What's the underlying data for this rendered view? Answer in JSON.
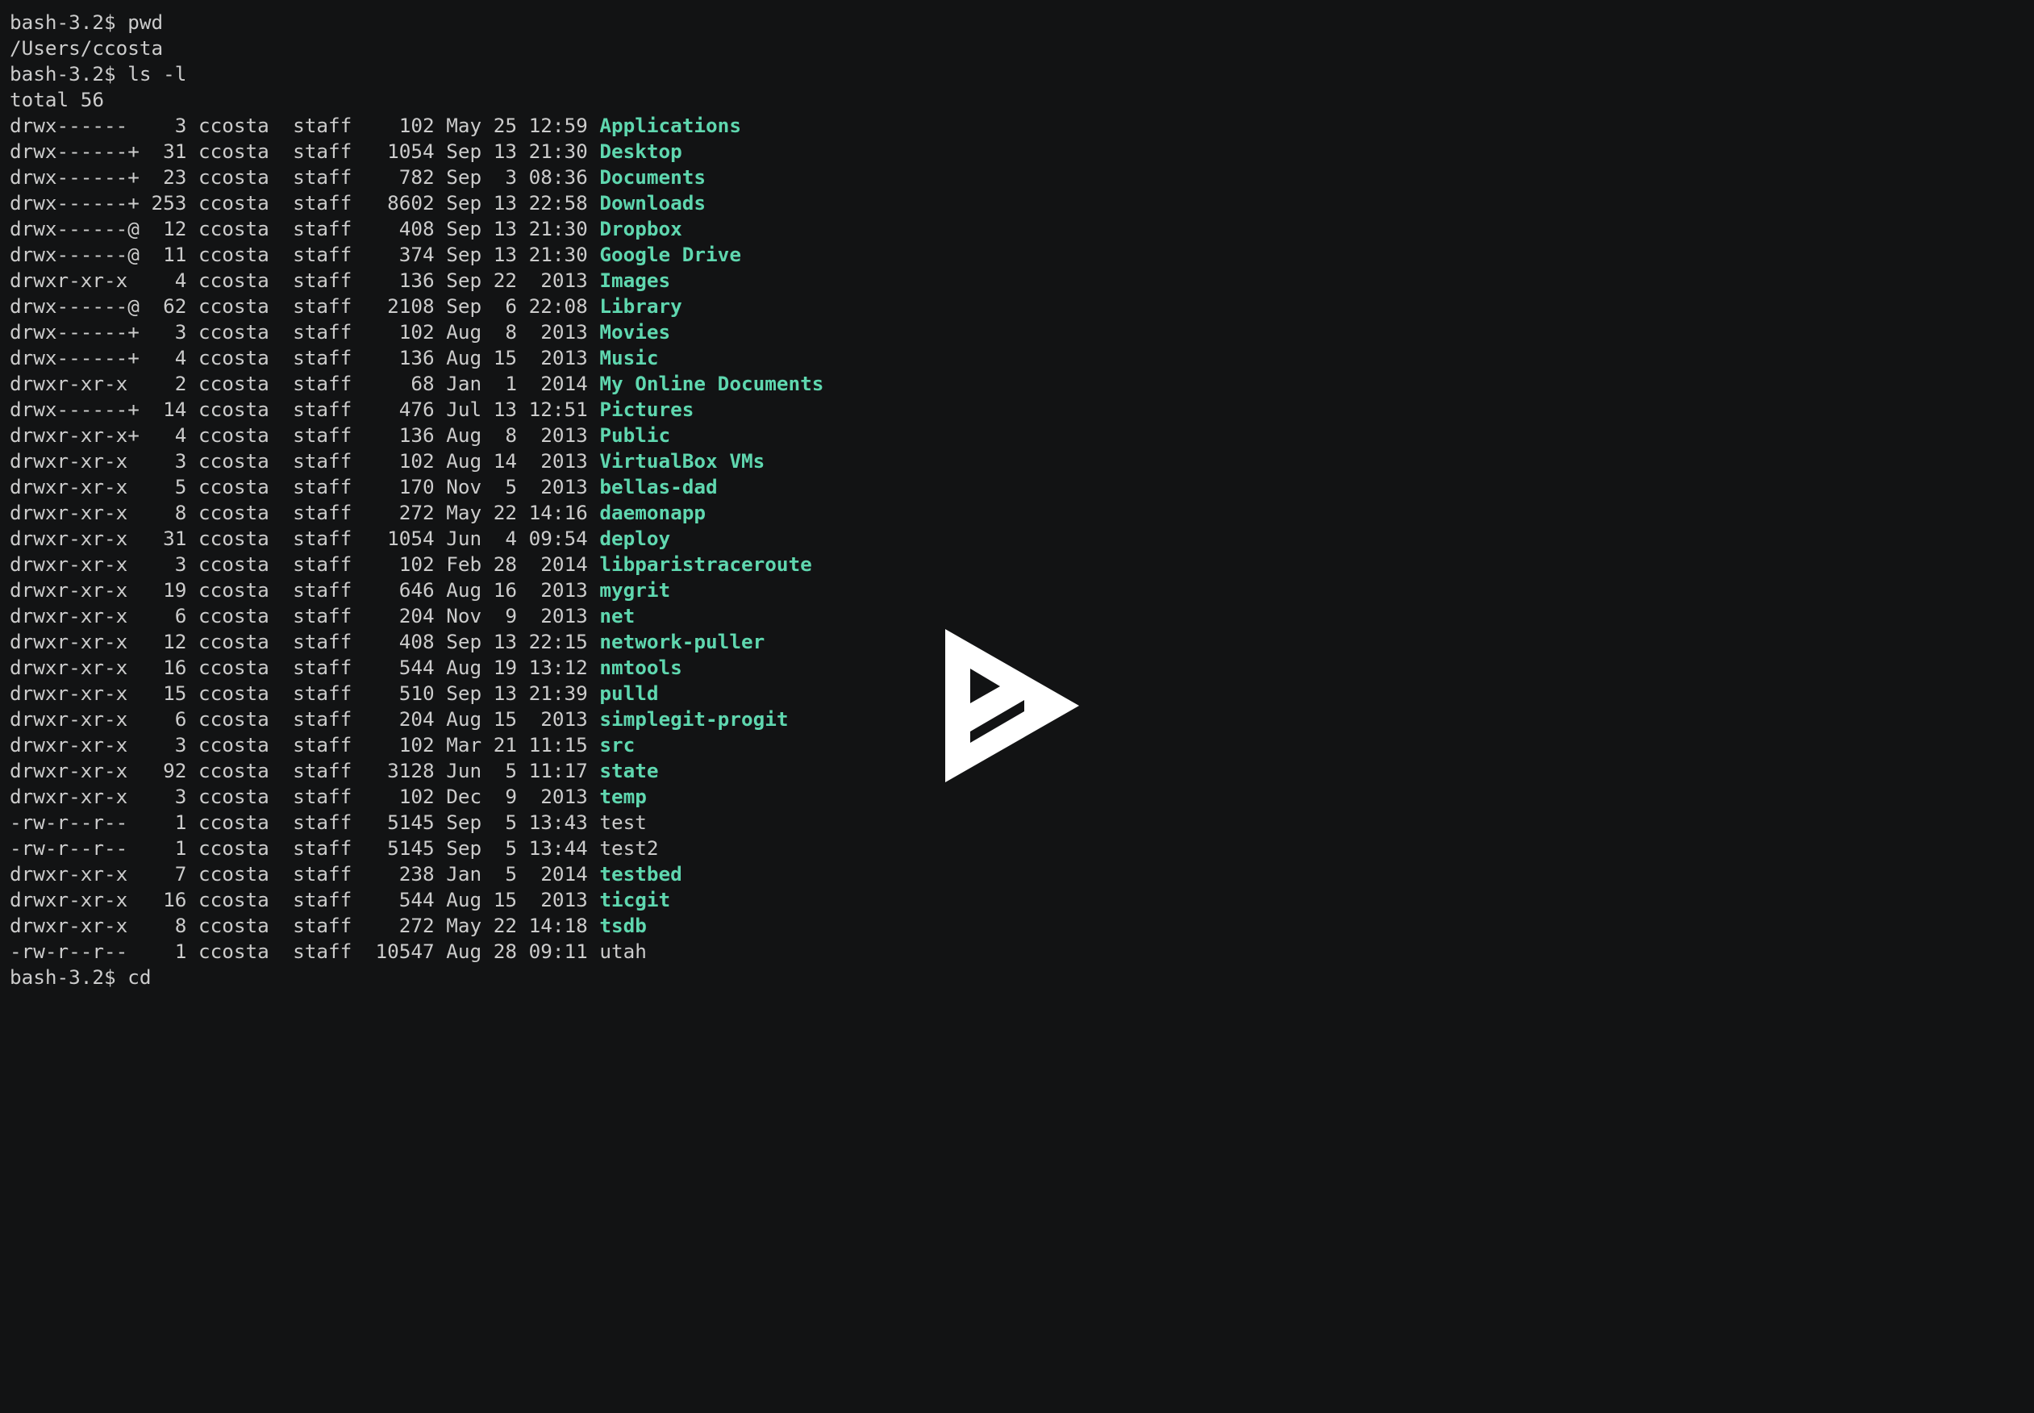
{
  "colors": {
    "background": "#121314",
    "foreground": "#cccccc",
    "directory": "#5fd7af"
  },
  "terminal": {
    "lines": [
      {
        "type": "text",
        "text": "bash-3.2$ pwd"
      },
      {
        "type": "text",
        "text": "/Users/ccosta"
      },
      {
        "type": "text",
        "text": "bash-3.2$ ls -l"
      },
      {
        "type": "text",
        "text": "total 56"
      },
      {
        "type": "entry",
        "meta": "drwx------    3 ccosta  staff    102 May 25 12:59 ",
        "name": "Applications",
        "kind": "dir"
      },
      {
        "type": "entry",
        "meta": "drwx------+  31 ccosta  staff   1054 Sep 13 21:30 ",
        "name": "Desktop",
        "kind": "dir"
      },
      {
        "type": "entry",
        "meta": "drwx------+  23 ccosta  staff    782 Sep  3 08:36 ",
        "name": "Documents",
        "kind": "dir"
      },
      {
        "type": "entry",
        "meta": "drwx------+ 253 ccosta  staff   8602 Sep 13 22:58 ",
        "name": "Downloads",
        "kind": "dir"
      },
      {
        "type": "entry",
        "meta": "drwx------@  12 ccosta  staff    408 Sep 13 21:30 ",
        "name": "Dropbox",
        "kind": "dir"
      },
      {
        "type": "entry",
        "meta": "drwx------@  11 ccosta  staff    374 Sep 13 21:30 ",
        "name": "Google Drive",
        "kind": "dir"
      },
      {
        "type": "entry",
        "meta": "drwxr-xr-x    4 ccosta  staff    136 Sep 22  2013 ",
        "name": "Images",
        "kind": "dir"
      },
      {
        "type": "entry",
        "meta": "drwx------@  62 ccosta  staff   2108 Sep  6 22:08 ",
        "name": "Library",
        "kind": "dir"
      },
      {
        "type": "entry",
        "meta": "drwx------+   3 ccosta  staff    102 Aug  8  2013 ",
        "name": "Movies",
        "kind": "dir"
      },
      {
        "type": "entry",
        "meta": "drwx------+   4 ccosta  staff    136 Aug 15  2013 ",
        "name": "Music",
        "kind": "dir"
      },
      {
        "type": "entry",
        "meta": "drwxr-xr-x    2 ccosta  staff     68 Jan  1  2014 ",
        "name": "My Online Documents",
        "kind": "dir"
      },
      {
        "type": "entry",
        "meta": "drwx------+  14 ccosta  staff    476 Jul 13 12:51 ",
        "name": "Pictures",
        "kind": "dir"
      },
      {
        "type": "entry",
        "meta": "drwxr-xr-x+   4 ccosta  staff    136 Aug  8  2013 ",
        "name": "Public",
        "kind": "dir"
      },
      {
        "type": "entry",
        "meta": "drwxr-xr-x    3 ccosta  staff    102 Aug 14  2013 ",
        "name": "VirtualBox VMs",
        "kind": "dir"
      },
      {
        "type": "entry",
        "meta": "drwxr-xr-x    5 ccosta  staff    170 Nov  5  2013 ",
        "name": "bellas-dad",
        "kind": "dir"
      },
      {
        "type": "entry",
        "meta": "drwxr-xr-x    8 ccosta  staff    272 May 22 14:16 ",
        "name": "daemonapp",
        "kind": "dir"
      },
      {
        "type": "entry",
        "meta": "drwxr-xr-x   31 ccosta  staff   1054 Jun  4 09:54 ",
        "name": "deploy",
        "kind": "dir"
      },
      {
        "type": "entry",
        "meta": "drwxr-xr-x    3 ccosta  staff    102 Feb 28  2014 ",
        "name": "libparistraceroute",
        "kind": "dir"
      },
      {
        "type": "entry",
        "meta": "drwxr-xr-x   19 ccosta  staff    646 Aug 16  2013 ",
        "name": "mygrit",
        "kind": "dir"
      },
      {
        "type": "entry",
        "meta": "drwxr-xr-x    6 ccosta  staff    204 Nov  9  2013 ",
        "name": "net",
        "kind": "dir"
      },
      {
        "type": "entry",
        "meta": "drwxr-xr-x   12 ccosta  staff    408 Sep 13 22:15 ",
        "name": "network-puller",
        "kind": "dir"
      },
      {
        "type": "entry",
        "meta": "drwxr-xr-x   16 ccosta  staff    544 Aug 19 13:12 ",
        "name": "nmtools",
        "kind": "dir"
      },
      {
        "type": "entry",
        "meta": "drwxr-xr-x   15 ccosta  staff    510 Sep 13 21:39 ",
        "name": "pulld",
        "kind": "dir"
      },
      {
        "type": "entry",
        "meta": "drwxr-xr-x    6 ccosta  staff    204 Aug 15  2013 ",
        "name": "simplegit-progit",
        "kind": "dir"
      },
      {
        "type": "entry",
        "meta": "drwxr-xr-x    3 ccosta  staff    102 Mar 21 11:15 ",
        "name": "src",
        "kind": "dir"
      },
      {
        "type": "entry",
        "meta": "drwxr-xr-x   92 ccosta  staff   3128 Jun  5 11:17 ",
        "name": "state",
        "kind": "dir"
      },
      {
        "type": "entry",
        "meta": "drwxr-xr-x    3 ccosta  staff    102 Dec  9  2013 ",
        "name": "temp",
        "kind": "dir"
      },
      {
        "type": "entry",
        "meta": "-rw-r--r--    1 ccosta  staff   5145 Sep  5 13:43 ",
        "name": "test",
        "kind": "file"
      },
      {
        "type": "entry",
        "meta": "-rw-r--r--    1 ccosta  staff   5145 Sep  5 13:44 ",
        "name": "test2",
        "kind": "file"
      },
      {
        "type": "entry",
        "meta": "drwxr-xr-x    7 ccosta  staff    238 Jan  5  2014 ",
        "name": "testbed",
        "kind": "dir"
      },
      {
        "type": "entry",
        "meta": "drwxr-xr-x   16 ccosta  staff    544 Aug 15  2013 ",
        "name": "ticgit",
        "kind": "dir"
      },
      {
        "type": "entry",
        "meta": "drwxr-xr-x    8 ccosta  staff    272 May 22 14:18 ",
        "name": "tsdb",
        "kind": "dir"
      },
      {
        "type": "entry",
        "meta": "-rw-r--r--    1 ccosta  staff  10547 Aug 28 09:11 ",
        "name": "utah",
        "kind": "file"
      },
      {
        "type": "text",
        "text": "bash-3.2$ cd"
      }
    ]
  },
  "overlay": {
    "icon": "asciinema-play-icon"
  }
}
